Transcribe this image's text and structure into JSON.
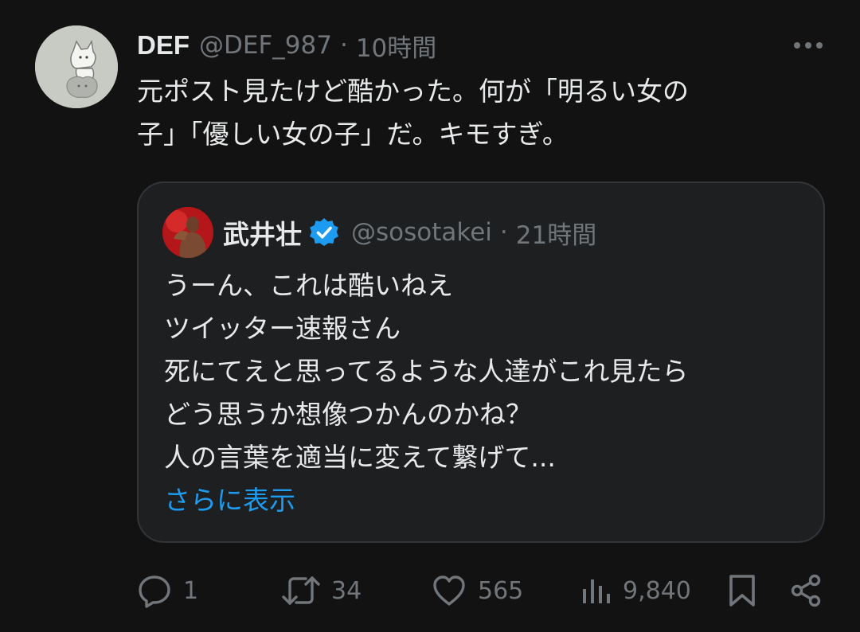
{
  "post": {
    "author_name": "DEF",
    "author_handle": "@DEF_987",
    "separator": "·",
    "time": "10時間",
    "text_lines": [
      "元ポスト見たけど酷かった。何が「明るい女の",
      "子」「優しい女の子」だ。キモすぎ。"
    ]
  },
  "quote": {
    "author_name": "武井壮",
    "author_handle": "@sosotakei",
    "separator": "·",
    "time": "21時間",
    "verified": true,
    "text_lines": [
      "うーん、これは酷いねえ",
      "ツイッター速報さん",
      "死にてえと思ってるような人達がこれ見たら",
      "どう思うか想像つかんのかね？",
      "人の言葉を適当に変えて繋げて..."
    ],
    "show_more": "さらに表示"
  },
  "actions": {
    "reply_count": "1",
    "repost_count": "34",
    "like_count": "565",
    "view_count": "9,840"
  },
  "icons": {
    "more": "more-horizontal-icon",
    "verified": "verified-badge-icon",
    "reply": "reply-icon",
    "repost": "repost-icon",
    "like": "heart-icon",
    "views": "views-icon",
    "bookmark": "bookmark-icon",
    "share": "share-icon"
  },
  "colors": {
    "background": "#121212",
    "text": "#e7e9ea",
    "muted": "#71767b",
    "accent": "#1d9bf0"
  }
}
